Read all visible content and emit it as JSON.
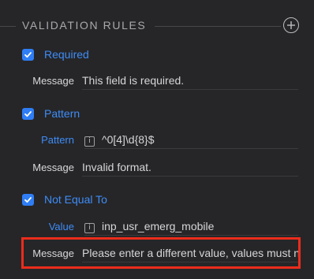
{
  "section": {
    "title": "VALIDATION RULES",
    "add_icon": "plus-circle-icon"
  },
  "rules": [
    {
      "label": "Required",
      "checked": true,
      "props": [
        {
          "label": "Message",
          "value": "This field is required.",
          "label_style": "plain"
        }
      ]
    },
    {
      "label": "Pattern",
      "checked": true,
      "props": [
        {
          "label": "Pattern",
          "value": "^0[4]\\d{8}$",
          "label_style": "link",
          "icon": "info-icon"
        },
        {
          "label": "Message",
          "value": "Invalid format.",
          "label_style": "plain"
        }
      ]
    },
    {
      "label": "Not Equal To",
      "checked": true,
      "props": [
        {
          "label": "Value",
          "value": "inp_usr_emerg_mobile",
          "label_style": "link",
          "icon": "info-icon"
        },
        {
          "label": "Message",
          "value": "Please enter a different value, values must not be the same.",
          "label_style": "plain"
        }
      ]
    }
  ],
  "colors": {
    "background": "#262628",
    "accent": "#2f7ef6",
    "link": "#3e8cf7",
    "highlight": "#ec2c1c"
  },
  "info_glyph": "i"
}
